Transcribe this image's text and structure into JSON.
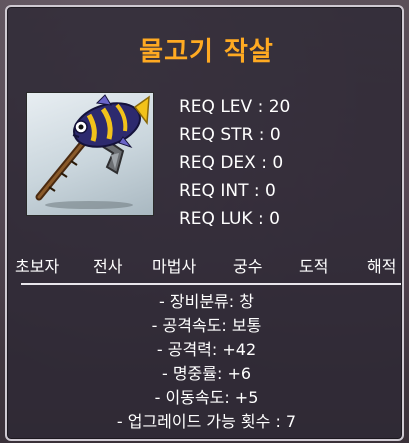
{
  "item": {
    "name": "물고기 작살",
    "icon": "fish-spear-icon"
  },
  "requirements": [
    "REQ LEV : 20",
    "REQ STR : 0",
    "REQ DEX : 0",
    "REQ INT : 0",
    "REQ LUK : 0"
  ],
  "jobs": [
    "초보자",
    "전사",
    "마법사",
    "궁수",
    "도적",
    "해적"
  ],
  "stats": [
    "- 장비분류: 창",
    "- 공격속도: 보통",
    "- 공격력: +42",
    "- 명중률: +6",
    "- 이동속도: +5",
    "- 업그레이드 가능 횟수 : 7"
  ],
  "colors": {
    "title": "#ffaa22",
    "text": "#ffffff",
    "border": "#cfcad2"
  }
}
